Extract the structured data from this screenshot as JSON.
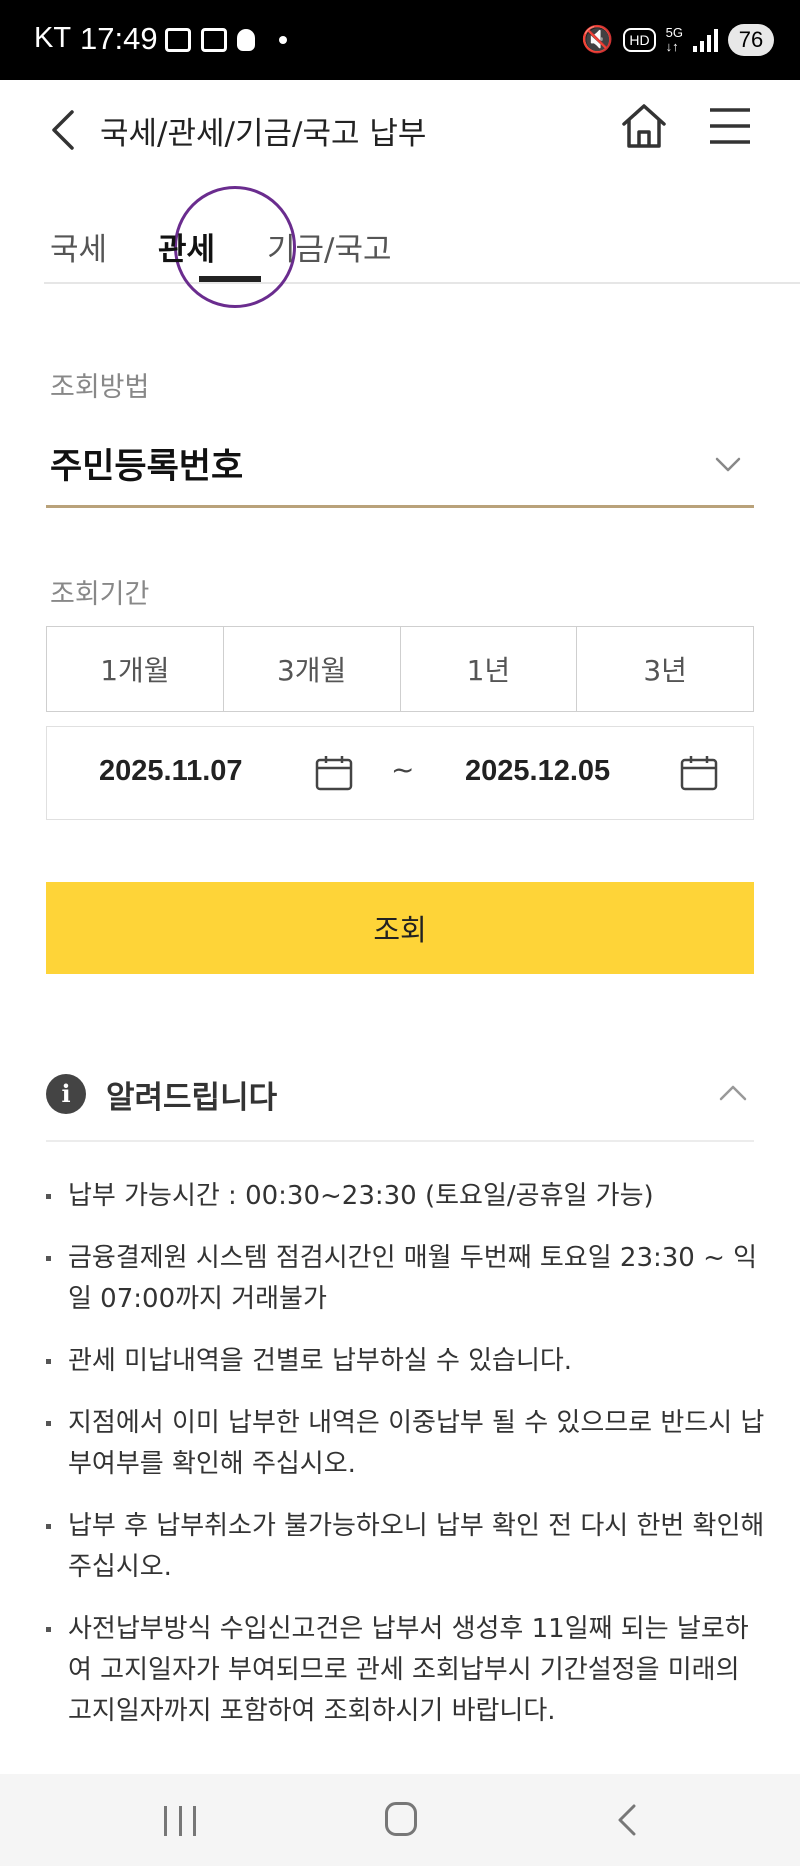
{
  "status_bar": {
    "carrier": "KT",
    "time": "17:49",
    "battery": "76"
  },
  "header": {
    "title": "국세/관세/기금/국고 납부",
    "icons": [
      "back-icon",
      "home-icon",
      "menu-icon"
    ]
  },
  "tabs": [
    {
      "label": "국세",
      "active": false
    },
    {
      "label": "관세",
      "active": true
    },
    {
      "label": "기금/국고",
      "active": false
    }
  ],
  "form": {
    "method_label": "조회방법",
    "method_value": "주민등록번호",
    "period_label": "조회기간",
    "period_options": [
      "1개월",
      "3개월",
      "1년",
      "3년"
    ],
    "start_date": "2025.11.07",
    "end_date": "2025.12.05",
    "date_separator": "~",
    "search_label": "조회"
  },
  "notice": {
    "title": "알려드립니다",
    "items": [
      "납부 가능시간 : 00:30~23:30 (토요일/공휴일 가능)",
      "금융결제원 시스템 점검시간인 매월 두번째 토요일 23:30 ~ 익일 07:00까지 거래불가",
      "관세 미납내역을 건별로 납부하실 수 있습니다.",
      "지점에서 이미 납부한 내역은 이중납부 될 수 있으므로 반드시 납부여부를 확인해 주십시오.",
      "납부 후 납부취소가 불가능하오니 납부 확인 전 다시 한번 확인해 주십시오.",
      "사전납부방식 수입신고건은 납부서 생성후 11일째 되는 날로하여 고지일자가 부여되므로 관세 조회납부시 기간설정을 미래의 고지일자까지 포함하여 조회하시기 바랍니다."
    ]
  },
  "colors": {
    "accent_yellow": "#fed438",
    "underline_gold": "#b9a27a",
    "highlight_circle": "#6a2c8e"
  }
}
